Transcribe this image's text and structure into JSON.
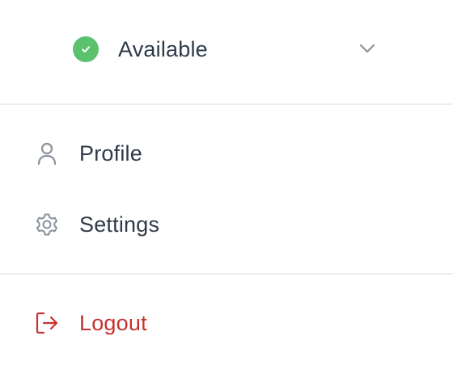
{
  "status": {
    "label": "Available",
    "color": "#5ac26d",
    "icon": "check-icon",
    "dropdown_icon": "chevron-down-icon"
  },
  "menu": {
    "items": [
      {
        "label": "Profile",
        "icon": "user-icon"
      },
      {
        "label": "Settings",
        "icon": "gear-icon"
      }
    ],
    "logout": {
      "label": "Logout",
      "icon": "logout-icon",
      "color": "#c6322f"
    }
  }
}
